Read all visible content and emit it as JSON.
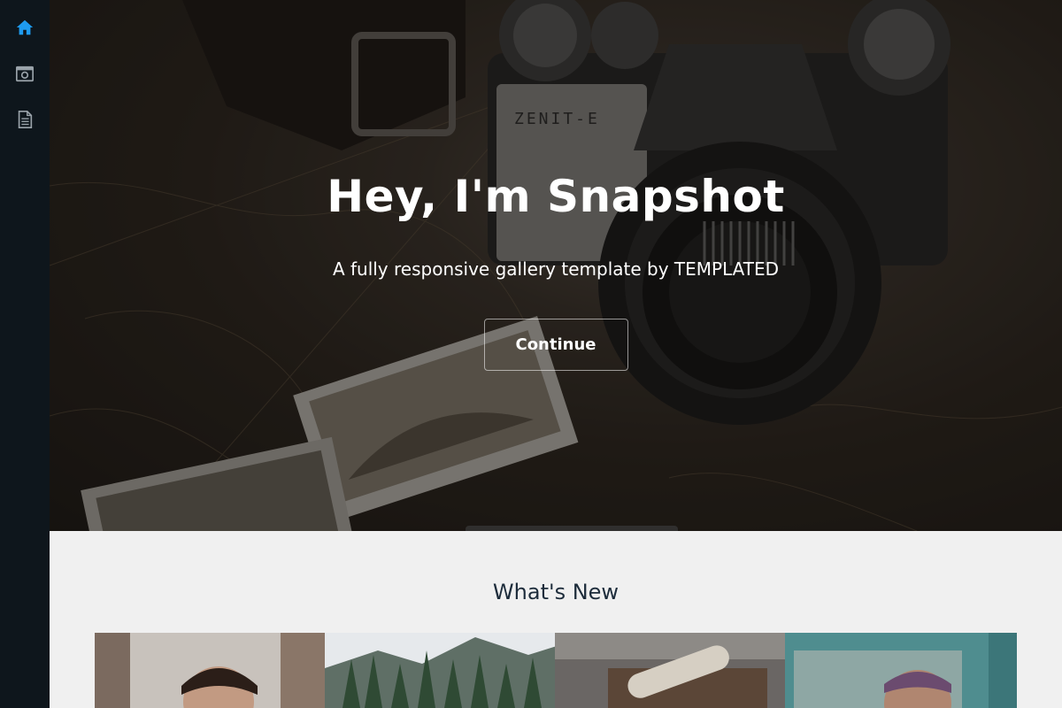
{
  "sidebar": {
    "items": [
      {
        "icon": "home-icon",
        "active": true
      },
      {
        "icon": "camera-icon",
        "active": false
      },
      {
        "icon": "document-icon",
        "active": false
      }
    ]
  },
  "banner": {
    "title": "Hey, I'm Snapshot",
    "subtitle": "A fully responsive gallery template by TEMPLATED",
    "button_label": "Continue"
  },
  "section": {
    "title": "What's New"
  },
  "colors": {
    "sidebar_bg": "#0e161c",
    "accent": "#1e9bf0",
    "section_bg": "#f0f0f0",
    "section_title": "#1d2c3b"
  },
  "gallery": {
    "items": [
      {
        "subject": "portrait of man"
      },
      {
        "subject": "forest mountain landscape"
      },
      {
        "subject": "skateboard on car"
      },
      {
        "subject": "woman with bandana in car"
      }
    ]
  }
}
